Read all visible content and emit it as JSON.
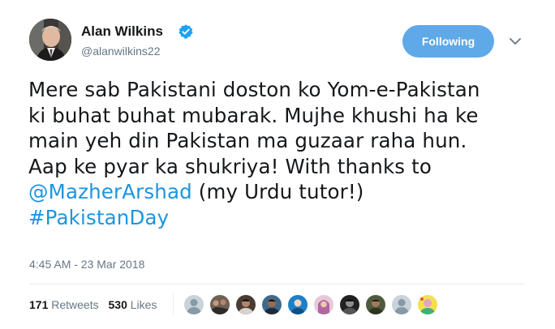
{
  "user": {
    "display_name": "Alan Wilkins",
    "handle": "@alanwilkins22",
    "verified": true,
    "avatar_icon": "profile-photo"
  },
  "follow_button": {
    "label": "Following",
    "color": "#5fa9e9"
  },
  "menu": {
    "icon": "chevron-down-icon"
  },
  "tweet": {
    "line1": "Mere sab Pakistani doston ko Yom-e-Pakistan",
    "line2": "ki buhat buhat mubarak. Mujhe khushi ha ke",
    "line3": "main yeh din Pakistan ma guzaar raha hun.",
    "line4": "Aap ke pyar ka shukriya! With thanks to",
    "mention": "@MazherArshad",
    "line5_rest": " (my Urdu tutor!)",
    "hashtag": "#PakistanDay",
    "link_color": "#1b95e0"
  },
  "timestamp": "4:45 AM - 23 Mar 2018",
  "stats": {
    "retweets_count": "171",
    "retweets_label": "Retweets",
    "likes_count": "530",
    "likes_label": "Likes"
  },
  "likers": [
    {
      "name": "default-avatar"
    },
    {
      "name": "group-photo"
    },
    {
      "name": "portrait-photo"
    },
    {
      "name": "portrait-photo"
    },
    {
      "name": "blue-avatar"
    },
    {
      "name": "hijab-avatar"
    },
    {
      "name": "portrait-photo"
    },
    {
      "name": "portrait-photo"
    },
    {
      "name": "default-avatar"
    },
    {
      "name": "colorful-avatar"
    }
  ]
}
